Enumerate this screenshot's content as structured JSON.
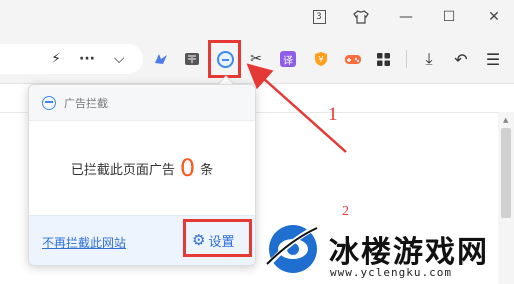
{
  "titlebar": {
    "tab_count": "3",
    "shirt_icon": "shirt-icon",
    "min_glyph": "—",
    "max_glyph": "☐",
    "close_glyph": "✕"
  },
  "toolbar": {
    "bolt": "⚡",
    "more": "···",
    "chevron": "⌵",
    "ext_translate": "译",
    "ext_coupon": "¥",
    "scissors": "✂",
    "download": "⤓",
    "undo": "↶",
    "menu": "☰",
    "accent_color": "#3d8bef",
    "highlight_color": "#e53935"
  },
  "popup": {
    "title": "广告拦截",
    "body_prefix": "已拦截此页面广告",
    "blocked_count": "0",
    "body_suffix": "条",
    "no_block_link": "不再拦截此网站",
    "settings_label": "设置"
  },
  "annotations": {
    "step1": "1",
    "step2": "2"
  },
  "watermark": {
    "name": "冰楼游戏网",
    "url": "www.yclengku.com"
  }
}
